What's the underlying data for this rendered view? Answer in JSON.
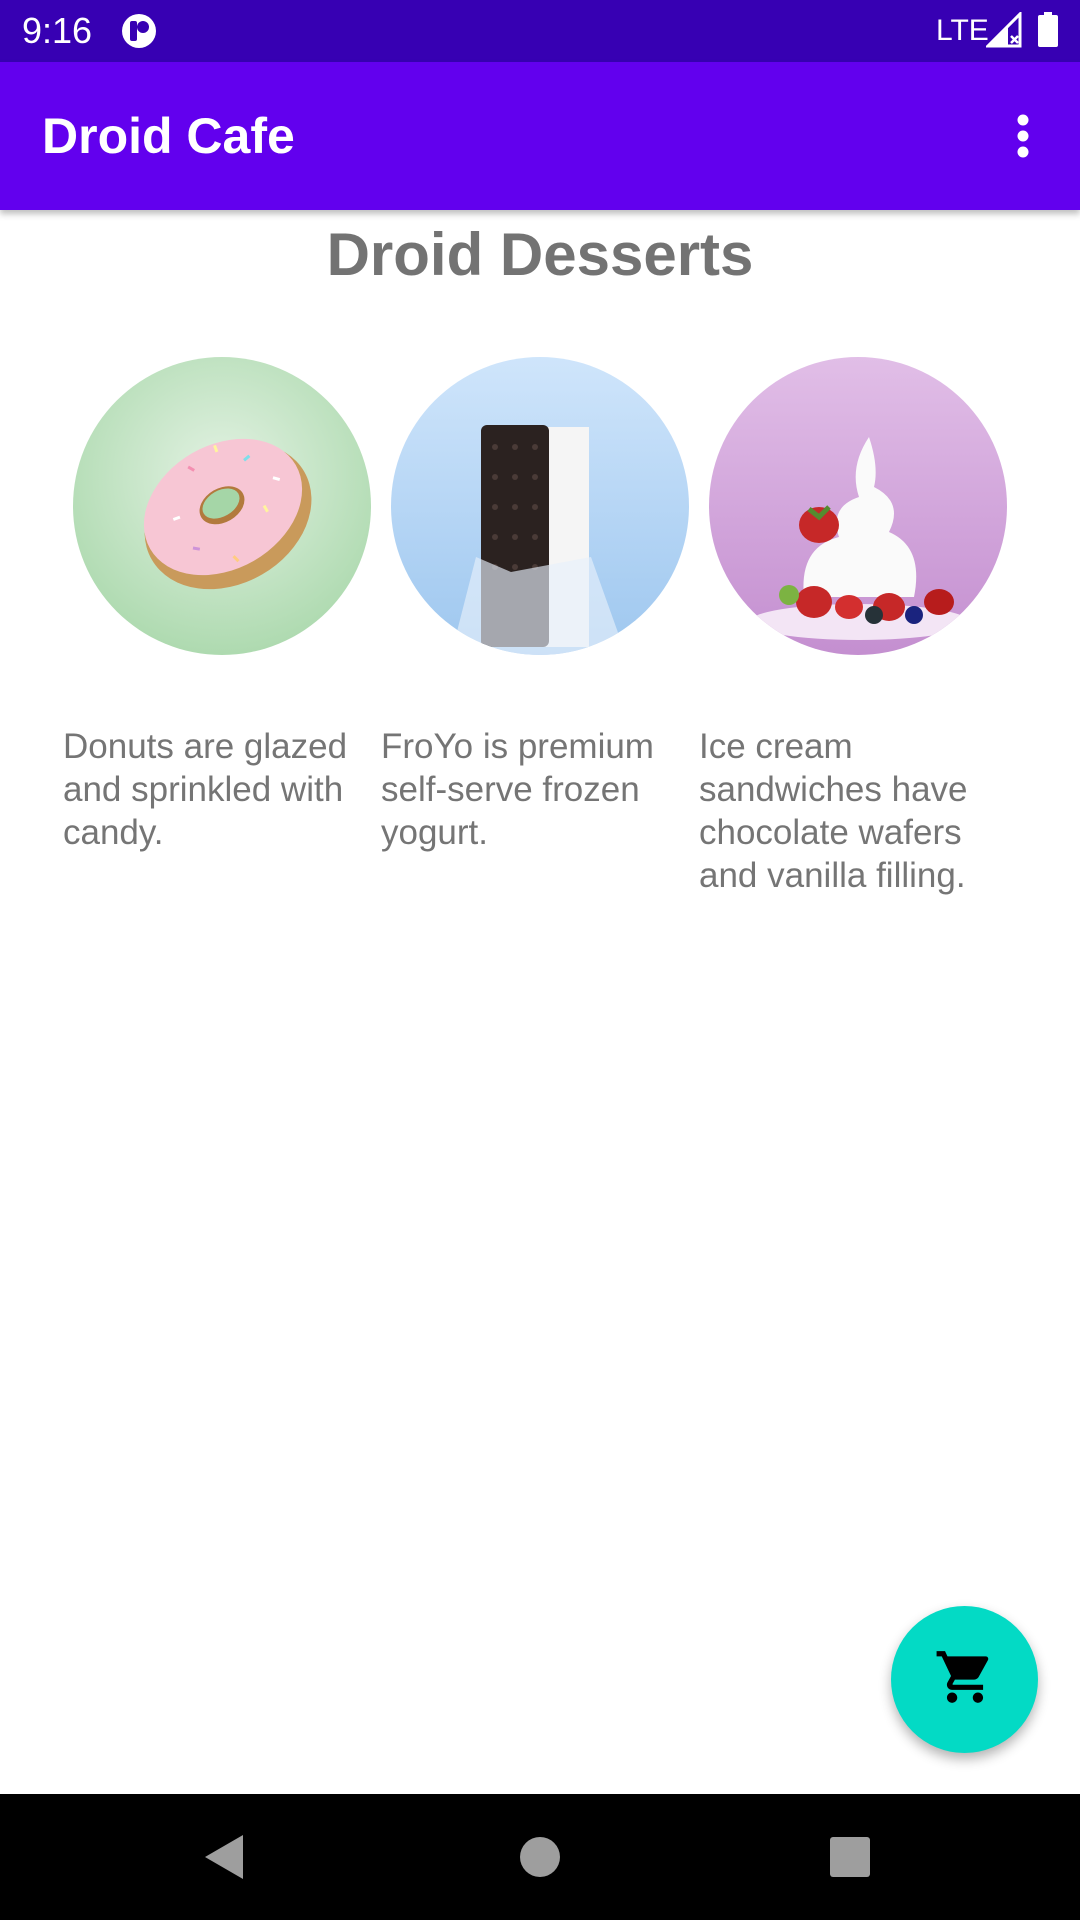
{
  "status_bar": {
    "time": "9:16",
    "network": "LTE",
    "app_icon": "app-notification-icon",
    "signal_icon": "signal-icon",
    "battery_icon": "battery-icon",
    "background_color": "#3700b3"
  },
  "app_bar": {
    "title": "Droid Cafe",
    "menu_icon": "more-vert-icon",
    "background_color": "#6200ee"
  },
  "main": {
    "heading": "Droid Desserts",
    "desserts": [
      {
        "name": "donut",
        "image": "donut-image",
        "description": "Donuts are glazed and sprinkled with candy."
      },
      {
        "name": "ice-cream-sandwich",
        "image": "ice-cream-sandwich-image",
        "description": "FroYo is premium self-serve frozen yogurt."
      },
      {
        "name": "froyo",
        "image": "froyo-image",
        "description": "Ice cream sandwiches have chocolate wafers and vanilla filling."
      }
    ]
  },
  "fab": {
    "icon": "shopping-cart-icon",
    "color": "#03dac5"
  },
  "nav_bar": {
    "back_icon": "back-icon",
    "home_icon": "home-icon",
    "recents_icon": "recents-icon"
  }
}
